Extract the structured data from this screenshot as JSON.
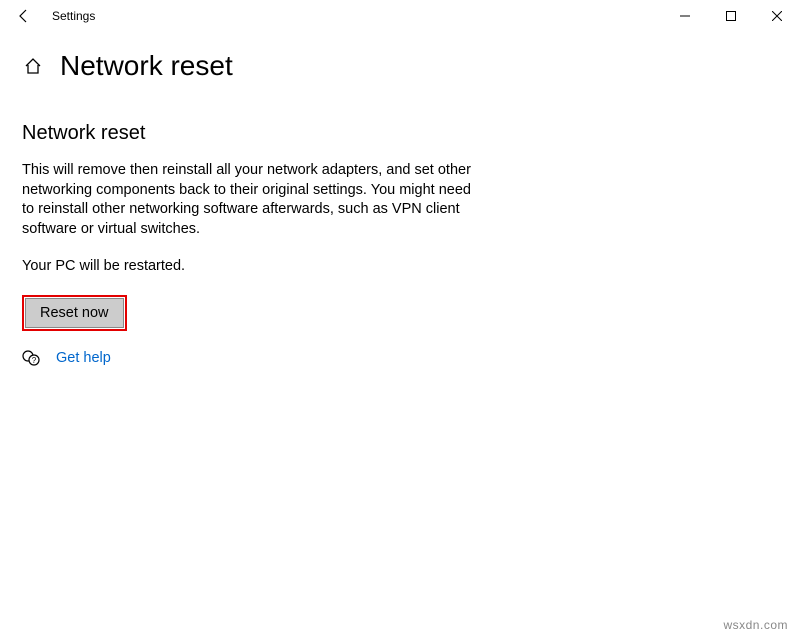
{
  "window": {
    "app_name": "Settings",
    "controls": {
      "minimize": "minimize",
      "maximize": "maximize",
      "close": "close"
    }
  },
  "header": {
    "title": "Network reset"
  },
  "main": {
    "heading": "Network reset",
    "description": "This will remove then reinstall all your network adapters, and set other networking components back to their original settings. You might need to reinstall other networking software afterwards, such as VPN client software or virtual switches.",
    "restart_note": "Your PC will be restarted.",
    "reset_button": "Reset now",
    "help_link": "Get help"
  },
  "watermark": "wsxdn.com"
}
